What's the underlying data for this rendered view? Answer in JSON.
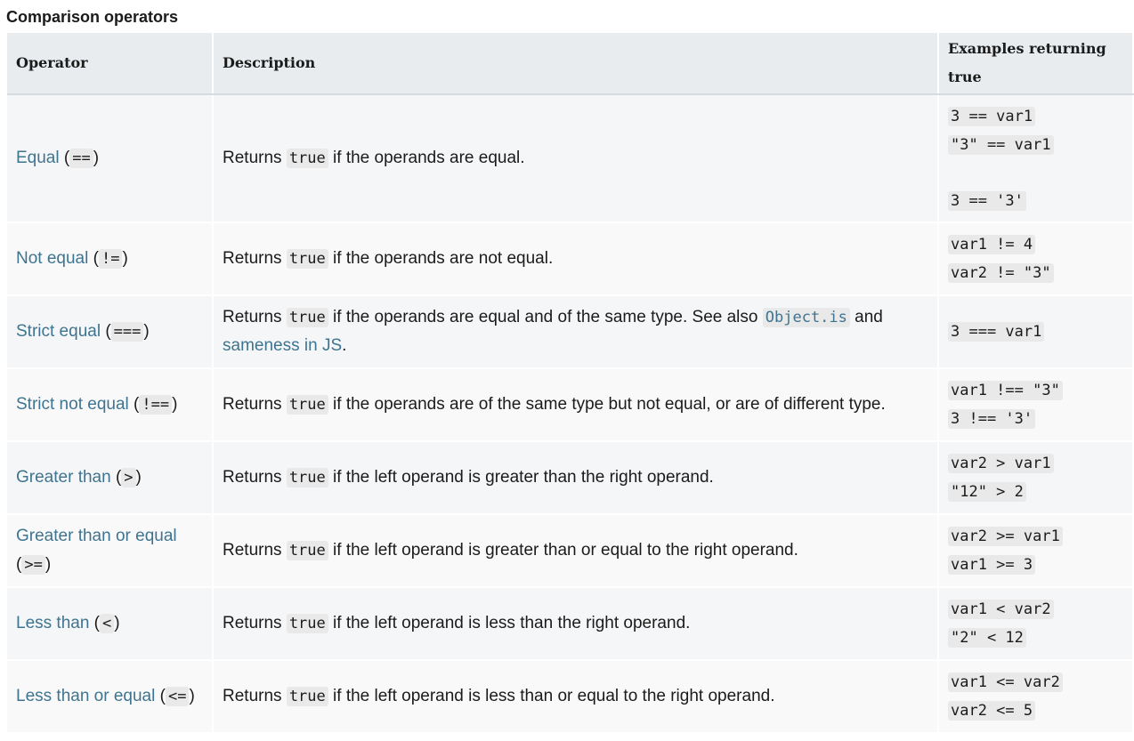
{
  "caption": "Comparison operators",
  "headers": {
    "operator": "Operator",
    "description": "Description",
    "examples": "Examples returning true"
  },
  "rows": [
    {
      "name": "Equal",
      "open": " (",
      "symbol": "==",
      "close": ")",
      "desc_before": "Returns ",
      "desc_code": "true",
      "desc_after": " if the operands are equal.",
      "examples": [
        "3 == var1",
        "\"3\" == var1",
        "3 == '3'"
      ]
    },
    {
      "name": "Not equal",
      "open": " (",
      "symbol": "!=",
      "close": ")",
      "desc_before": "Returns ",
      "desc_code": "true",
      "desc_after": " if the operands are not equal.",
      "examples": [
        "var1 != 4",
        "var2 != \"3\""
      ]
    },
    {
      "name": "Strict equal",
      "open": " (",
      "symbol": "===",
      "close": ")",
      "desc_before": "Returns ",
      "desc_code": "true",
      "desc_after": " if the operands are equal and of the same type. See also ",
      "desc_link1": "Object.is",
      "desc_mid": " and ",
      "desc_link2": "sameness in JS",
      "desc_end": ".",
      "examples": [
        "3 === var1"
      ]
    },
    {
      "name": "Strict not equal",
      "open": " (",
      "symbol": "!==",
      "close": ")",
      "desc_before": "Returns ",
      "desc_code": "true",
      "desc_after": " if the operands are of the same type but not equal, or are of different type.",
      "examples": [
        "var1 !== \"3\"",
        "3 !== '3'"
      ]
    },
    {
      "name": "Greater than",
      "open": " (",
      "symbol": ">",
      "close": ")",
      "desc_before": "Returns ",
      "desc_code": "true",
      "desc_after": " if the left operand is greater than the right operand.",
      "examples": [
        "var2 > var1",
        "\"12\" > 2"
      ]
    },
    {
      "name": "Greater than or equal",
      "open": "(",
      "symbol": ">=",
      "close": ")",
      "desc_before": "Returns ",
      "desc_code": "true",
      "desc_after": " if the left operand is greater than or equal to the right operand.",
      "examples": [
        "var2 >= var1",
        "var1 >= 3"
      ]
    },
    {
      "name": "Less than",
      "open": " (",
      "symbol": "<",
      "close": ")",
      "desc_before": "Returns ",
      "desc_code": "true",
      "desc_after": " if the left operand is less than the right operand.",
      "examples": [
        "var1 < var2",
        "\"2\" < 12"
      ]
    },
    {
      "name": "Less than or equal",
      "open": " (",
      "symbol": "<=",
      "close": ")",
      "desc_before": "Returns ",
      "desc_code": "true",
      "desc_after": " if the left operand is less than or equal to the right operand.",
      "examples": [
        "var1 <= var2",
        "var2 <= 5"
      ]
    }
  ],
  "colors": {
    "link": "#3f7490",
    "header_bg": "#e8ecef",
    "row_bg": "#f5f6f7",
    "code_bg": "#e9e9e9"
  }
}
